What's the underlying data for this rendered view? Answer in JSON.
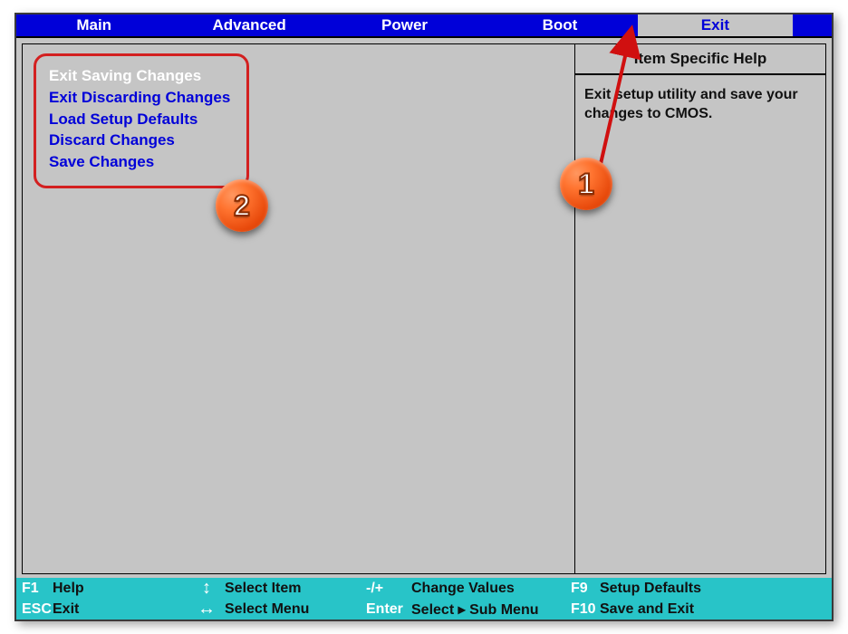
{
  "menu": {
    "items": [
      "Main",
      "Advanced",
      "Power",
      "Boot",
      "Exit"
    ],
    "active_index": 4
  },
  "exit_options": {
    "items": [
      {
        "label": "Exit Saving Changes",
        "selected": true
      },
      {
        "label": "Exit Discarding Changes",
        "selected": false
      },
      {
        "label": "Load Setup Defaults",
        "selected": false
      },
      {
        "label": "Discard Changes",
        "selected": false
      },
      {
        "label": "Save Changes",
        "selected": false
      }
    ]
  },
  "help": {
    "title": "Item Specific Help",
    "body": "Exit setup utility and save your changes to CMOS."
  },
  "keys": {
    "f1": "F1",
    "f1_label": "Help",
    "esc": "ESC",
    "esc_label": "Exit",
    "updown_label": "Select Item",
    "leftright_label": "Select Menu",
    "plusminus": "-/+",
    "plusminus_label": "Change Values",
    "enter": "Enter",
    "enter_label": "Select ▸ Sub Menu",
    "f9": "F9",
    "f9_label": "Setup Defaults",
    "f10": "F10",
    "f10_label": "Save and Exit"
  },
  "annotations": {
    "badge1": "1",
    "badge2": "2"
  },
  "colors": {
    "menu_bg": "#0000d9",
    "panel_bg": "#c5c5c5",
    "keybar_bg": "#28c4c8",
    "highlight_border": "#d32020",
    "badge": "#ee5514"
  }
}
